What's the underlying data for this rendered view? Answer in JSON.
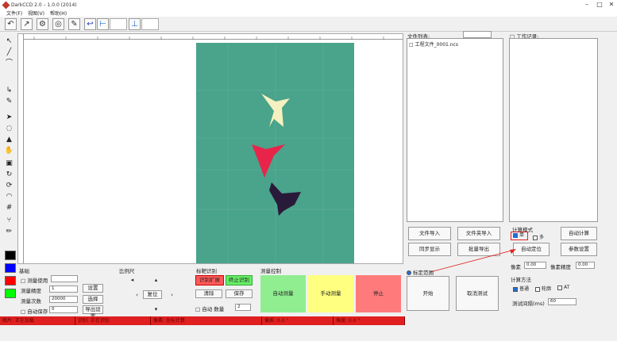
{
  "window": {
    "title": "DarkCCD 2.0 – 1.0.0 (2014)"
  },
  "menu": [
    "文件(F)",
    "视图(V)",
    "帮助(H)"
  ],
  "text_list": {
    "label": "文件列表:",
    "item": "□ 工程文件_0001.ncs"
  },
  "right_list": {
    "label": "□ 工作记录:"
  },
  "buttons": {
    "file_import": "文件导入",
    "multi_import": "文件夹导入",
    "sync_show": "同步显示",
    "batch_export": "批量导出",
    "auto_calc": "自动计算",
    "settings": "参数设置",
    "mode_label": "计算模式",
    "single": "单",
    "multi": "多",
    "auto_calib": "自动定位",
    "correct": "矫正模式",
    "big_start": "开始",
    "big_cancel": "取消测试"
  },
  "params": {
    "label_a": "像素",
    "val_a": "0.00",
    "label_b": "像素精度",
    "val_b": "0.00",
    "method_label": "计算方法",
    "opt1": "普通",
    "opt2": "轮廓",
    "opt3": "AT",
    "extra_label": "测试间隔(ms)",
    "extra_val": "60"
  },
  "bottom": {
    "group1_title": "基础",
    "g1_row1": "□ 测量使用",
    "g1_row2": "测量精度",
    "g1_val2": "1",
    "g1_row3": "测量次数",
    "g1_val3": "20000",
    "g1_row4": "□ 自动保存",
    "g1_val4": "0",
    "g1_btn1": "设置",
    "g1_btn2": "选择",
    "g1_btn3": "导出设置",
    "group2_title": "比例尺",
    "g2_btn": "复位",
    "group3_title": "标靶识别",
    "g3_btn1": "识别扩展",
    "g3_btn2": "终止识别",
    "g3_btn3": "清除",
    "g3_btn4": "保存",
    "g3_row": "□ 自动 数量",
    "g3_val": "2",
    "group4_title": "测量控制",
    "big_green": "自动测量",
    "big_yellow": "手动测量",
    "big_red": "停止"
  },
  "radio": {
    "label": "标定范围"
  },
  "status": [
    "图片: 正在加载",
    "识别: 正在识别",
    "像素: 坐标计算",
    "偏差: 0.0 °",
    "角度: 0.0 °"
  ],
  "colors": {
    "canvas_green": "#4aa38b",
    "swatch_black": "#000000",
    "swatch_blue": "#0000ff",
    "swatch_red": "#ff0000",
    "swatch_green": "#00ff00",
    "status_red": "#e02020"
  }
}
